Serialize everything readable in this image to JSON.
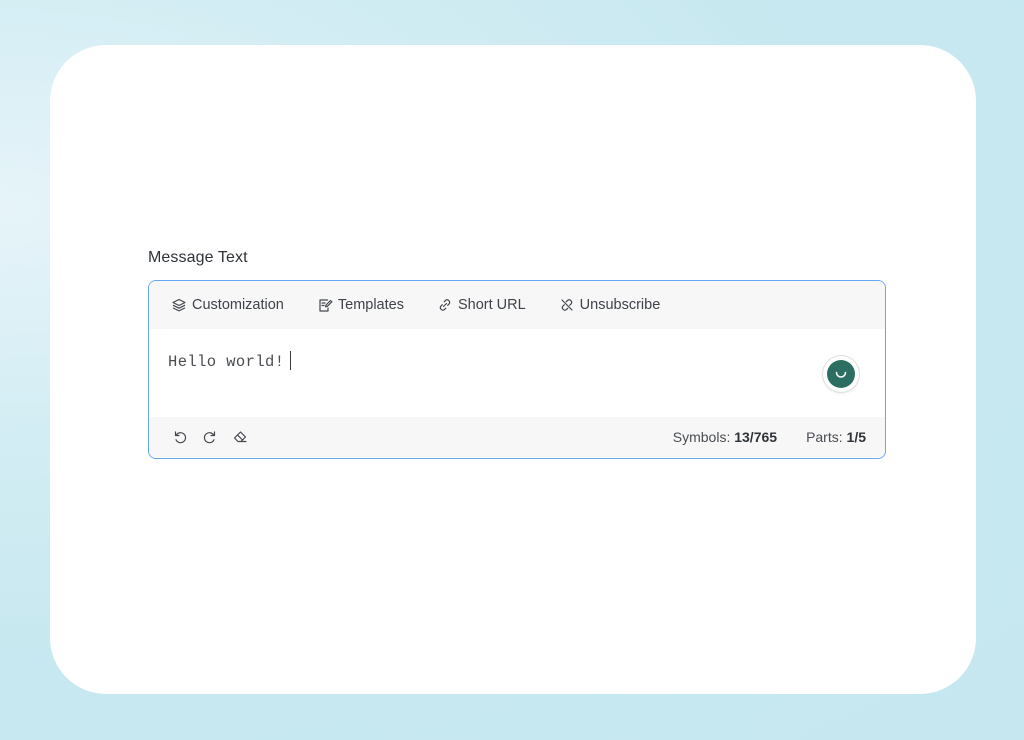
{
  "field": {
    "label": "Message Text"
  },
  "toolbar": {
    "items": [
      {
        "label": "Customization",
        "icon": "layers-icon"
      },
      {
        "label": "Templates",
        "icon": "template-icon"
      },
      {
        "label": "Short URL",
        "icon": "link-icon"
      },
      {
        "label": "Unsubscribe",
        "icon": "unlink-icon"
      }
    ]
  },
  "editor": {
    "value": "Hello world!",
    "assist_icon": "smile-icon",
    "assist_color": "#2c6f62",
    "border_color": "#66a6f3"
  },
  "footer": {
    "actions": [
      {
        "icon": "undo-icon"
      },
      {
        "icon": "redo-icon"
      },
      {
        "icon": "eraser-icon"
      }
    ],
    "symbols_label": "Symbols:",
    "symbols_value": "13/765",
    "parts_label": "Parts:",
    "parts_value": "1/5"
  }
}
